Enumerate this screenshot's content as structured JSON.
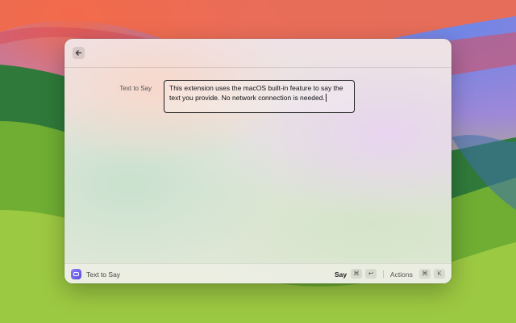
{
  "window": {
    "back_icon": "arrow-left-icon"
  },
  "form": {
    "label": "Text to Say",
    "text_value": "This extension uses the macOS built-in feature to say the text you provide. No network connection is needed."
  },
  "footer": {
    "extension_icon": "speech-bubble-icon",
    "extension_title": "Text to Say",
    "primary_action": "Say",
    "primary_keys": [
      "⌘",
      "↩"
    ],
    "secondary_action": "Actions",
    "secondary_keys": [
      "⌘",
      "K"
    ]
  },
  "colors": {
    "accent": "#6a5cf0",
    "border": "#1f1f1f"
  }
}
